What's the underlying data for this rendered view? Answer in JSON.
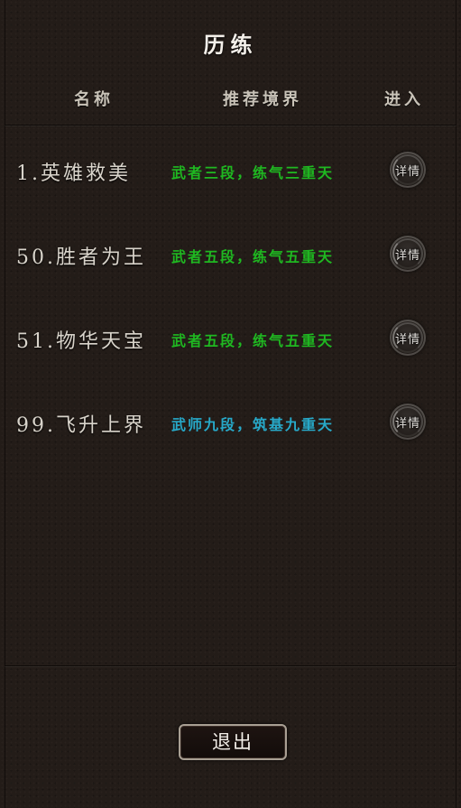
{
  "title": "历练",
  "header": {
    "name": "名称",
    "realm": "推荐境界",
    "enter": "进入"
  },
  "rows": [
    {
      "name": "1.英雄救美",
      "realm": "武者三段，练气三重天",
      "realm_color": "#1fb821",
      "detail_label": "详情",
      "icon": "detail-seal-icon"
    },
    {
      "name": "50.胜者为王",
      "realm": "武者五段，练气五重天",
      "realm_color": "#1fb821",
      "detail_label": "详情",
      "icon": "detail-seal-icon"
    },
    {
      "name": "51.物华天宝",
      "realm": "武者五段，练气五重天",
      "realm_color": "#1fb821",
      "detail_label": "详情",
      "icon": "detail-seal-icon"
    },
    {
      "name": "99.飞升上界",
      "realm": "武师九段，筑基九重天",
      "realm_color": "#27a9c9",
      "detail_label": "详情",
      "icon": "detail-seal-icon"
    }
  ],
  "exit_label": "退出"
}
